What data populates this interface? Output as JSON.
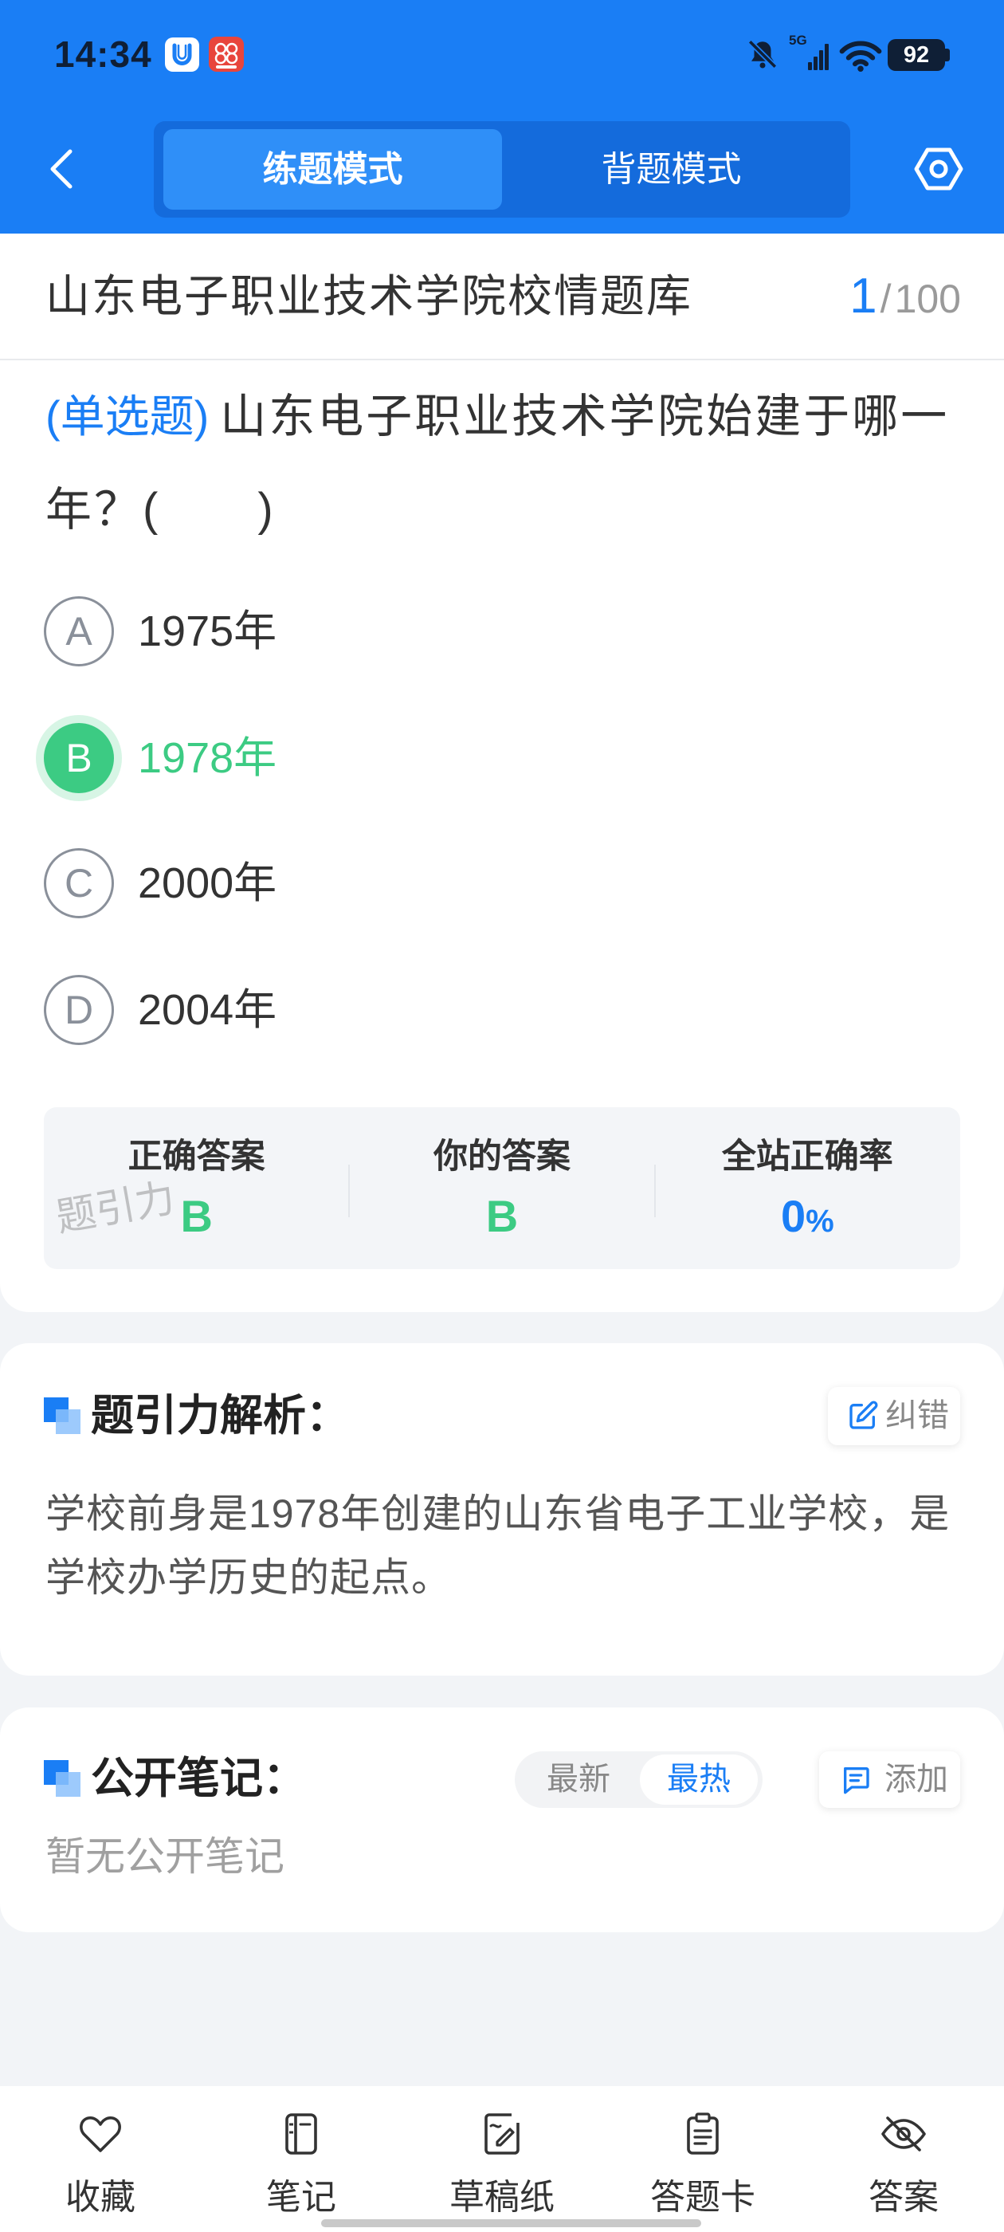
{
  "status_bar": {
    "time": "14:34",
    "network_label": "5G",
    "battery_level": "92",
    "icons": [
      "app-u-icon",
      "app-red-icon",
      "bell-muted-icon",
      "signal-icon",
      "wifi-icon",
      "battery-icon"
    ]
  },
  "header": {
    "tabs": [
      {
        "label": "练题模式",
        "active": true
      },
      {
        "label": "背题模式",
        "active": false
      }
    ],
    "icons": [
      "back-icon",
      "settings-icon"
    ]
  },
  "bank": {
    "title": "山东电子职业技术学院校情题库",
    "progress": {
      "current": "1",
      "separator": "/",
      "total": "100"
    }
  },
  "question": {
    "type_tag": "(单选题)",
    "text": "山东电子职业技术学院始建于哪一年？(　　)",
    "options": [
      {
        "letter": "A",
        "text": "1975年",
        "selected": false
      },
      {
        "letter": "B",
        "text": "1978年",
        "selected": true
      },
      {
        "letter": "C",
        "text": "2000年",
        "selected": false
      },
      {
        "letter": "D",
        "text": "2004年",
        "selected": false
      }
    ]
  },
  "result": {
    "correct_label": "正确答案",
    "correct_value": "B",
    "yours_label": "你的答案",
    "yours_value": "B",
    "rate_label": "全站正确率",
    "rate_value": "0",
    "rate_unit": "%",
    "watermark": "题引力"
  },
  "analysis": {
    "title": "题引力解析：",
    "report_label": "纠错",
    "text": "学校前身是1978年创建的山东省电子工业学校，是学校办学历史的起点。"
  },
  "notes": {
    "title": "公开笔记：",
    "sort_options": [
      {
        "label": "最新",
        "active": false
      },
      {
        "label": "最热",
        "active": true
      }
    ],
    "add_label": "添加",
    "empty_text": "暂无公开笔记"
  },
  "bottom_nav": [
    {
      "label": "收藏",
      "icon": "heart-icon"
    },
    {
      "label": "笔记",
      "icon": "notebook-icon"
    },
    {
      "label": "草稿纸",
      "icon": "draft-paper-icon"
    },
    {
      "label": "答题卡",
      "icon": "answer-sheet-icon"
    },
    {
      "label": "答案",
      "icon": "eye-off-icon"
    }
  ],
  "colors": {
    "primary": "#1a7ef5",
    "correct": "#3ccb83",
    "page_background": "#f2f4f7"
  }
}
